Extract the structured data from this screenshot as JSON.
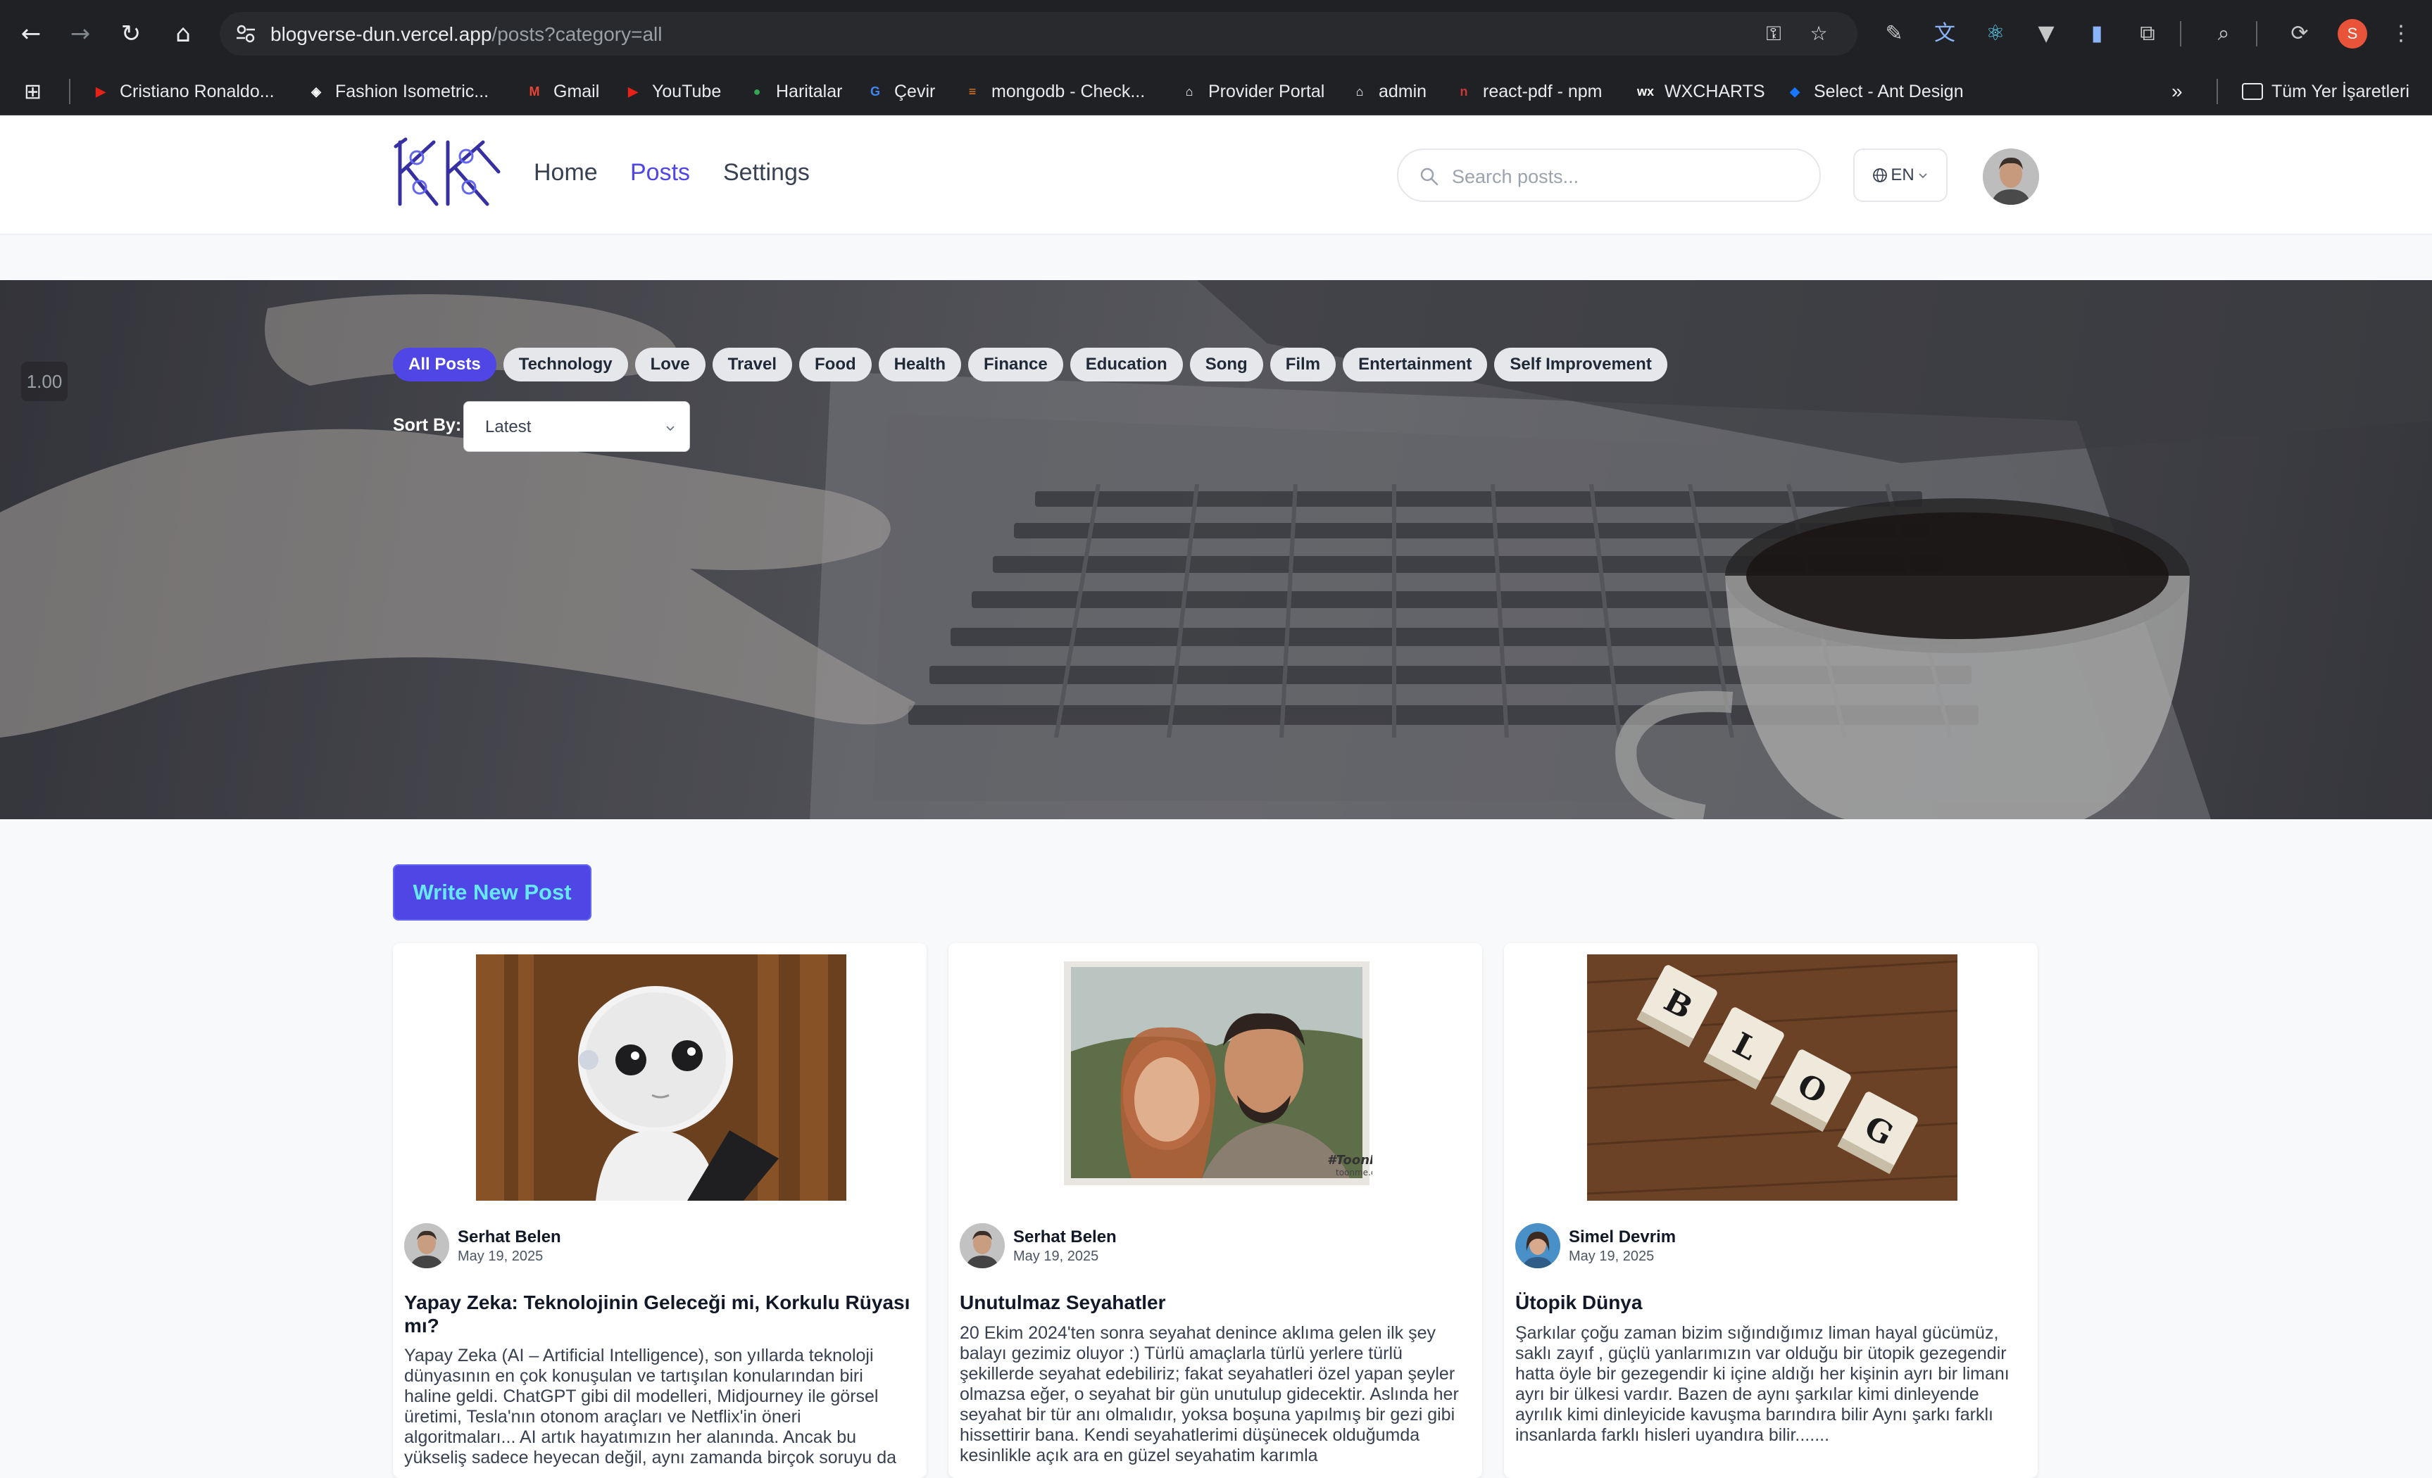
{
  "browser": {
    "url_host": "blogverse-dun.vercel.app",
    "url_path": "/posts?category=all",
    "profile_initial": "S",
    "bookmarks": [
      {
        "label": "Cristiano Ronaldo...",
        "icon": "youtube-icon",
        "color": "#e62117"
      },
      {
        "label": "Fashion Isometric...",
        "icon": "figma-icon",
        "color": "#ffffff"
      },
      {
        "label": "Gmail",
        "icon": "gmail-icon",
        "color": "#ea4335"
      },
      {
        "label": "YouTube",
        "icon": "youtube-icon",
        "color": "#e62117"
      },
      {
        "label": "Haritalar",
        "icon": "maps-pin-icon",
        "color": "#34a853"
      },
      {
        "label": "Çevir",
        "icon": "translate-icon",
        "color": "#4285f4"
      },
      {
        "label": "mongodb - Check...",
        "icon": "stackoverflow-icon",
        "color": "#f48024"
      },
      {
        "label": "Provider Portal",
        "icon": "home-icon",
        "color": "#ffffff"
      },
      {
        "label": "admin",
        "icon": "home-icon",
        "color": "#ffffff"
      },
      {
        "label": "react-pdf - npm",
        "icon": "npm-icon",
        "color": "#cb3837"
      },
      {
        "label": "WXCHARTS",
        "icon": "wx-icon",
        "color": "#ffffff"
      },
      {
        "label": "Select - Ant Design",
        "icon": "antdesign-icon",
        "color": "#1677ff"
      }
    ],
    "all_bookmarks_label": "Tüm Yer İşaretleri"
  },
  "header": {
    "nav": [
      "Home",
      "Posts",
      "Settings"
    ],
    "active_nav": "Posts",
    "search_placeholder": "Search posts...",
    "language": "EN"
  },
  "hero": {
    "zoom": "1.00",
    "categories": [
      "All Posts",
      "Technology",
      "Love",
      "Travel",
      "Food",
      "Health",
      "Finance",
      "Education",
      "Song",
      "Film",
      "Entertainment",
      "Self Improvement"
    ],
    "active_category": "All Posts",
    "sort_label": "Sort By:",
    "sort_value": "Latest"
  },
  "content": {
    "write_button": "Write New Post",
    "posts": [
      {
        "author": "Serhat Belen",
        "date": "May 19, 2025",
        "title": "Yapay Zeka: Teknolojinin Geleceği mi, Korkulu Rüyası mı?",
        "excerpt": "Yapay Zeka (AI – Artificial Intelligence), son yıllarda teknoloji dünyasının en çok konuşulan ve tartışılan konularından biri haline geldi. ChatGPT gibi dil modelleri, Midjourney ile görsel üretimi, Tesla'nın otonom araçları ve Netflix'in öneri algoritmaları... AI artık hayatımızın her alanında. Ancak bu yükseliş sadece heyecan değil, aynı zamanda birçok soruyu da"
      },
      {
        "author": "Serhat Belen",
        "date": "May 19, 2025",
        "title": "Unutulmaz Seyahatler",
        "excerpt": "20 Ekim 2024'ten sonra seyahat denince aklıma gelen ilk şey balayı gezimiz oluyor :) Türlü amaçlarla türlü yerlere türlü şekillerde seyahat edebiliriz; fakat seyahatleri özel yapan şeyler olmazsa eğer, o seyahat bir gün unutulup gidecektir. Aslında her seyahat bir tür anı olmalıdır, yoksa boşuna yapılmış bir gezi gibi hissettirir bana. Kendi seyahatlerimi düşünecek olduğumda kesinlikle açık ara en güzel seyahatim karımla",
        "image_watermark": "#ToonMe",
        "image_watermark_sub": "toonme.com"
      },
      {
        "author": "Simel Devrim",
        "date": "May 19, 2025",
        "title": "Ütopik Dünya",
        "excerpt": "Şarkılar çoğu zaman bizim sığındığımız liman hayal gücümüz, saklı zayıf , güçlü yanlarımızın var olduğu bir ütopik gezegendir hatta öyle bir gezegendir ki içine aldığı her kişinin ayrı bir limanı ayrı bir ülkesi vardır. Bazen de aynı şarkılar kimi dinleyende ayrılık kimi dinleyicide kavuşma barındıra bilir Aynı şarkı farklı insanlarda farklı hisleri uyandıra bilir.......",
        "image_tiles": [
          "B",
          "L",
          "O",
          "G"
        ]
      }
    ]
  },
  "colors": {
    "accent": "#4f46e5",
    "write_button_text": "#67e8f9",
    "chrome_bg": "#202124"
  }
}
